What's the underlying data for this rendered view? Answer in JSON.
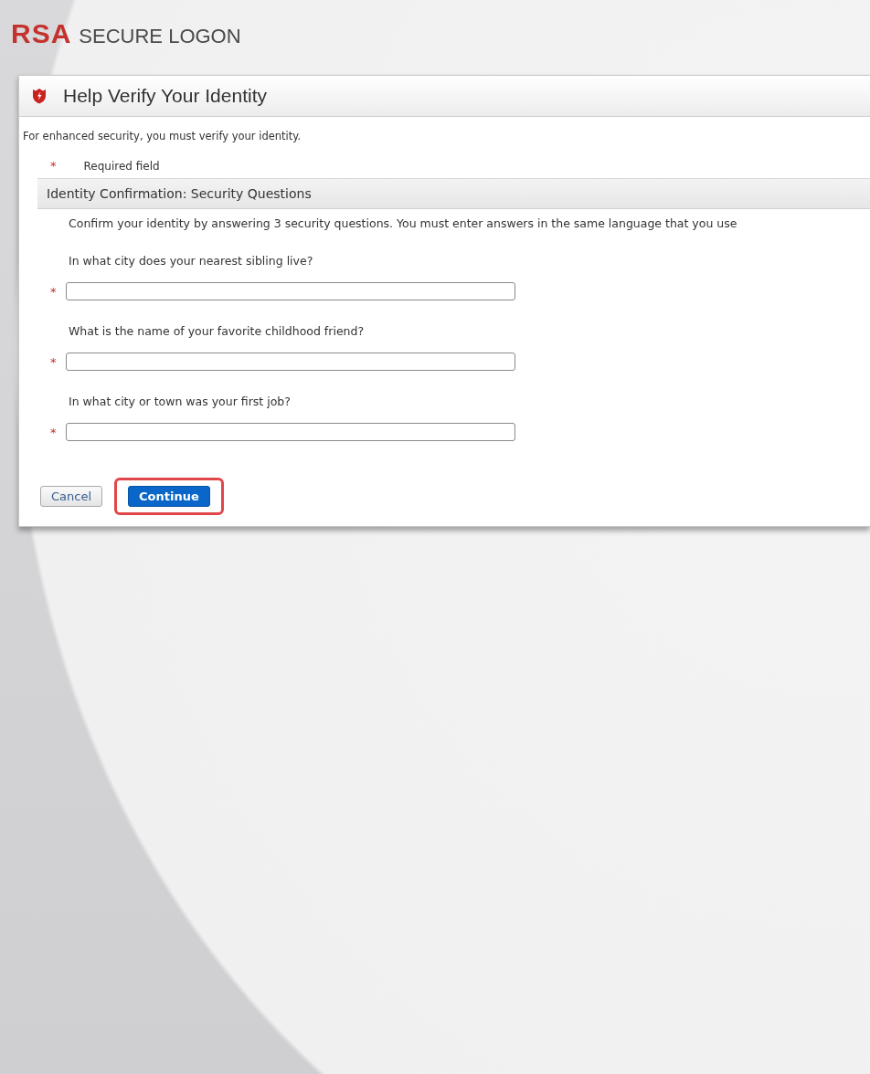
{
  "brand": {
    "logo": "RSA",
    "title": "SECURE LOGON"
  },
  "dialog": {
    "title": "Help Verify Your Identity",
    "intro": "For enhanced security, you must verify your identity.",
    "required_mark": "*",
    "required_note": "Required field",
    "section": {
      "title": "Identity Confirmation: Security Questions",
      "instructions": "Confirm your identity by answering 3 security questions. You must enter answers in the same language that you use",
      "questions": [
        {
          "label": "In what city does your nearest sibling live?",
          "required": true,
          "required_mark": "*"
        },
        {
          "label": "What is the name of your favorite childhood friend?",
          "required": true,
          "required_mark": "*"
        },
        {
          "label": "In what city or town was your first job?",
          "required": true,
          "required_mark": "*"
        }
      ]
    },
    "buttons": [
      {
        "label": "Cancel",
        "kind": "secondary",
        "highlighted": false
      },
      {
        "label": "Continue",
        "kind": "primary",
        "highlighted": true
      }
    ]
  }
}
